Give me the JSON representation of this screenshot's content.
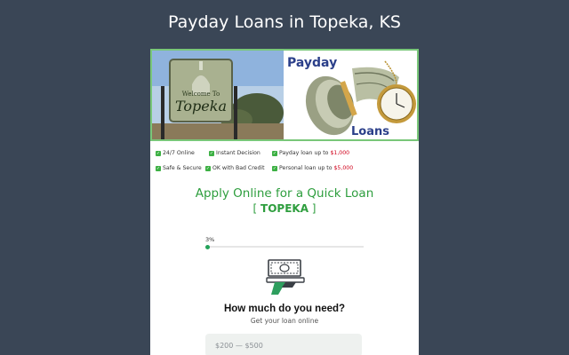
{
  "page": {
    "title": "Payday Loans in Topeka, KS"
  },
  "banner": {
    "sign_line1": "Welcome To",
    "sign_line2": "Topeka",
    "brand_top": "Payday",
    "brand_bottom": "Loans"
  },
  "features": {
    "row1": [
      {
        "text": "24/7 Online",
        "amount": ""
      },
      {
        "text": "Instant Decision",
        "amount": ""
      },
      {
        "text": "Payday loan up to ",
        "amount": "$1,000"
      }
    ],
    "row2": [
      {
        "text": "Safe & Secure",
        "amount": ""
      },
      {
        "text": "OK with Bad Credit",
        "amount": ""
      },
      {
        "text": "Personal loan up to ",
        "amount": "$5,000"
      }
    ],
    "check_glyph": "✓"
  },
  "form": {
    "heading": "Apply Online for a Quick Loan",
    "city_open": "[ ",
    "city": "TOPEKA",
    "city_close": " ]",
    "progress_text": "3%",
    "progress_value": 0.03,
    "question": "How much do you need?",
    "subtitle": "Get your loan online",
    "options": [
      "$200 — $500"
    ]
  },
  "colors": {
    "background": "#3a4656",
    "accent_green": "#2e9e3e",
    "progress": "#24a35a",
    "amount_red": "#d0021b"
  },
  "icons": {
    "check": "check-icon",
    "money": "cash-hand-icon"
  }
}
